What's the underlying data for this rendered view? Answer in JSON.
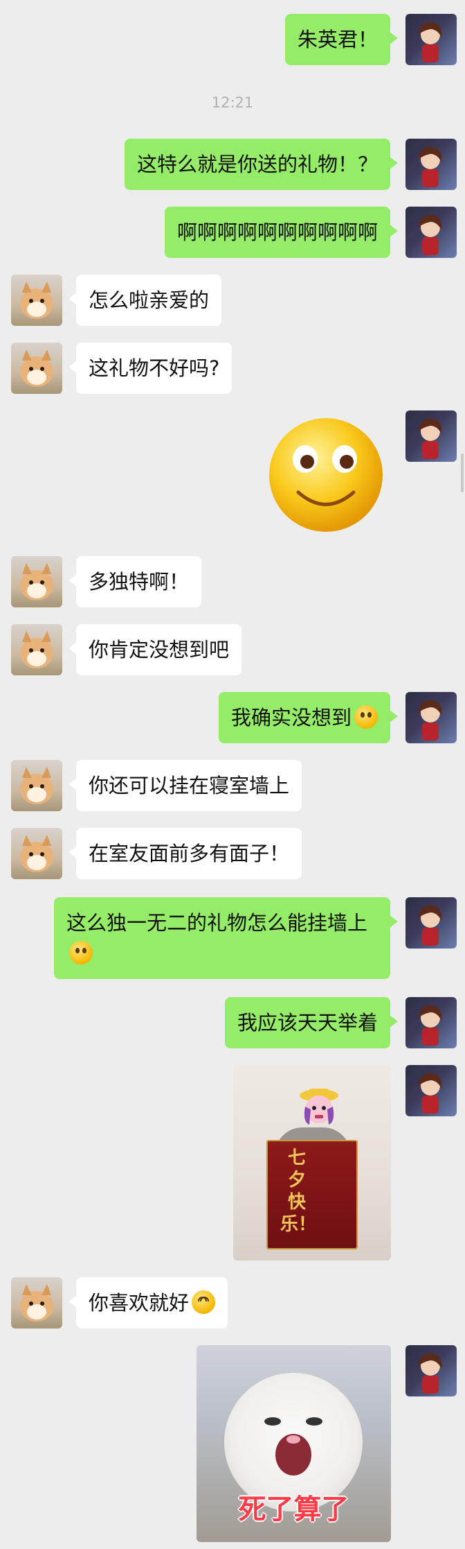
{
  "timestamp": "12:21",
  "messages": [
    {
      "text": "朱英君！"
    },
    {
      "text": "这特么就是你送的礼物！？"
    },
    {
      "text": "啊啊啊啊啊啊啊啊啊啊"
    },
    {
      "text": "怎么啦亲爱的"
    },
    {
      "text": "这礼物不好吗?"
    },
    {
      "text": "多独特啊！"
    },
    {
      "text": "你肯定没想到吧"
    },
    {
      "text": "我确实没想到"
    },
    {
      "text": "你还可以挂在寝室墙上"
    },
    {
      "text": "在室友面前多有面子！"
    },
    {
      "text": "这么独一无二的礼物怎么能挂墙上"
    },
    {
      "text": "我应该天天举着"
    },
    {
      "text": "你喜欢就好"
    }
  ],
  "stickers": {
    "banner_text": "七夕快乐！",
    "cat_caption": "死了算了"
  },
  "icons": {
    "smiley": "smiley-emoji-icon",
    "grin": "grin-emoji-icon"
  }
}
